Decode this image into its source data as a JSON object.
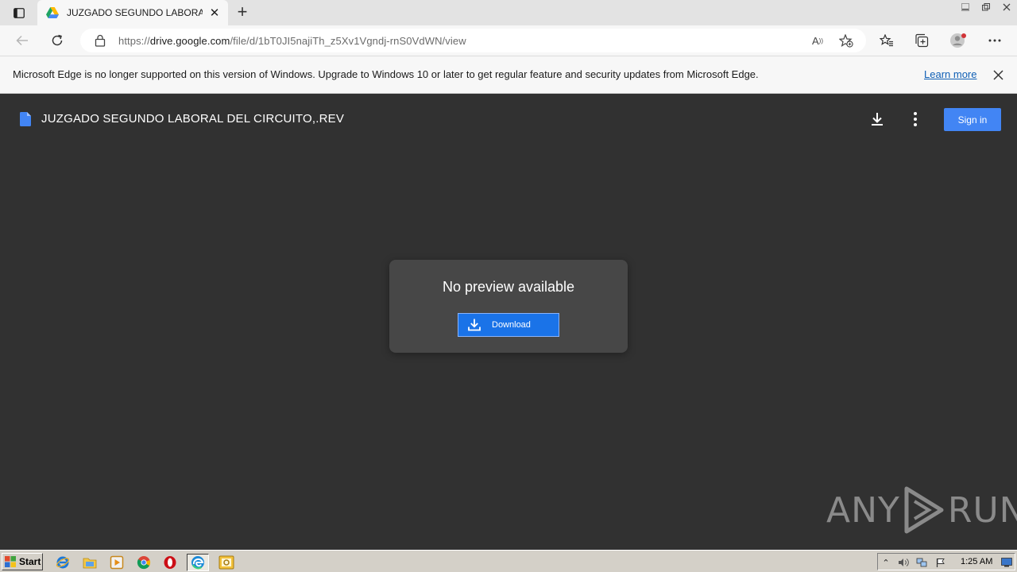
{
  "browser": {
    "tab": {
      "title": "JUZGADO SEGUNDO LABORAL D",
      "close": "✕"
    },
    "newtab": "+",
    "url": {
      "prefix": "https://",
      "host": "drive.google.com",
      "path": "/file/d/1bT0JI5najiTh_z5Xv1Vgndj-rnS0VdWN/view"
    },
    "read_aloud": "A",
    "colors": {
      "chrome": "#e3e3e3",
      "toolbar": "#f7f7f7"
    }
  },
  "infobar": {
    "message": "Microsoft Edge is no longer supported on this version of Windows. Upgrade to Windows 10 or later to get regular feature and security updates from Microsoft Edge.",
    "learn_more": "Learn more"
  },
  "viewer": {
    "file_title": "JUZGADO SEGUNDO LABORAL DEL CIRCUITO,.REV",
    "sign_in": "Sign in",
    "no_preview": "No preview available",
    "download": "Download",
    "watermark_left": "ANY",
    "watermark_right": "RUN",
    "colors": {
      "background": "#313131",
      "card": "#474747",
      "accent": "#1a73e8",
      "sign_in": "#4285f4"
    }
  },
  "taskbar": {
    "start": "Start",
    "apps": [
      "internet-explorer-icon",
      "file-explorer-icon",
      "media-player-icon",
      "chrome-icon",
      "opera-icon",
      "edge-icon",
      "outlook-icon"
    ],
    "clock": "1:25 AM"
  }
}
